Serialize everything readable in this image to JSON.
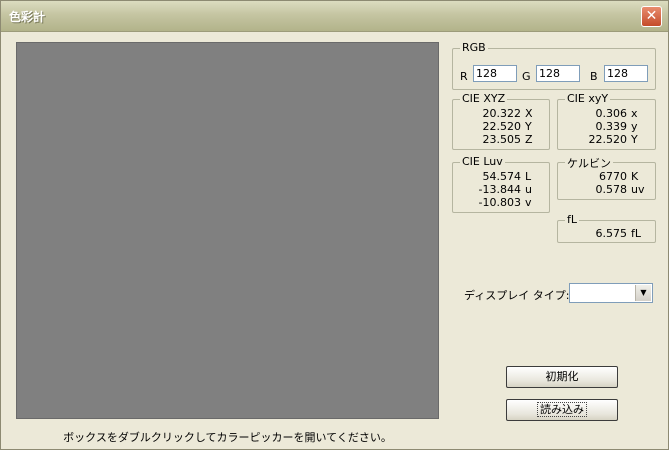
{
  "window": {
    "title": "色彩計",
    "close_glyph": "✕"
  },
  "swatch": {
    "color": "#808080",
    "caption": "ボックスをダブルクリックしてカラーピッカーを開いてください。"
  },
  "rgb": {
    "title": "RGB",
    "r_label": "R",
    "r_value": "128",
    "g_label": "G",
    "g_value": "128",
    "b_label": "B",
    "b_value": "128"
  },
  "cie_xyz": {
    "title": "CIE XYZ",
    "rows": [
      {
        "value": "20.322",
        "unit": "X"
      },
      {
        "value": "22.520",
        "unit": "Y"
      },
      {
        "value": "23.505",
        "unit": "Z"
      }
    ]
  },
  "cie_xyy": {
    "title": "CIE xyY",
    "rows": [
      {
        "value": "0.306",
        "unit": "x"
      },
      {
        "value": "0.339",
        "unit": "y"
      },
      {
        "value": "22.520",
        "unit": "Y"
      }
    ]
  },
  "cie_luv": {
    "title": "CIE Luv",
    "rows": [
      {
        "value": "54.574",
        "unit": "L"
      },
      {
        "value": "-13.844",
        "unit": "u"
      },
      {
        "value": "-10.803",
        "unit": "v"
      }
    ]
  },
  "kelvin": {
    "title": "ケルビン",
    "rows": [
      {
        "value": "6770",
        "unit": "K"
      },
      {
        "value": "0.578",
        "unit": "uv"
      }
    ]
  },
  "fl": {
    "title": "fL",
    "rows": [
      {
        "value": "6.575",
        "unit": "fL"
      }
    ]
  },
  "display_type": {
    "label": "ディスプレイ タイプ:",
    "value": "",
    "arrow_glyph": "▼"
  },
  "buttons": {
    "reset": "初期化",
    "load": "読み込み"
  }
}
